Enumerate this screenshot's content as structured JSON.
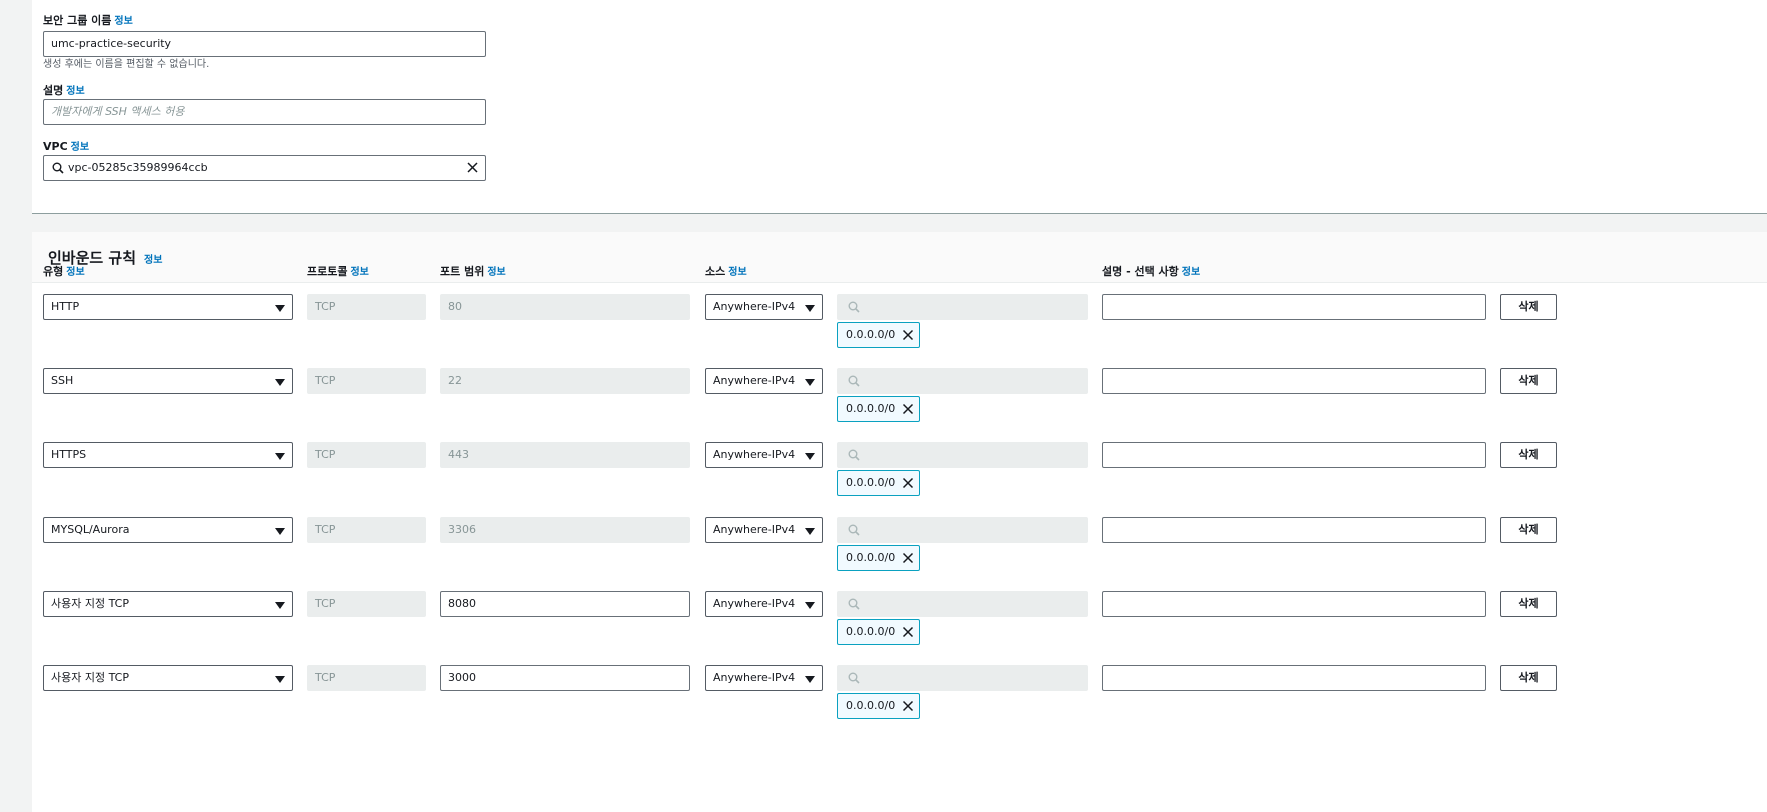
{
  "top": {
    "name_label": "보안 그룹 이름",
    "name_info": "정보",
    "name_value": "umc-practice-security",
    "name_hint": "생성 후에는 이름을 편집할 수 없습니다.",
    "desc_label": "설명",
    "desc_info": "정보",
    "desc_placeholder": "개발자에게 SSH 액세스 허용",
    "vpc_label": "VPC",
    "vpc_info": "정보",
    "vpc_value": "vpc-05285c35989964ccb"
  },
  "inbound": {
    "title": "인바운드 규칙",
    "title_info": "정보",
    "headers": {
      "type": "유형",
      "protocol": "프로토콜",
      "port": "포트 범위",
      "source": "소스",
      "description": "설명 - 선택 사항"
    },
    "info_label": "정보",
    "rows": [
      {
        "type": "HTTP",
        "protocol": "TCP",
        "port": "80",
        "port_editable": false,
        "source": "Anywhere-IPv4",
        "cidr": "0.0.0.0/0",
        "delete": "삭제"
      },
      {
        "type": "SSH",
        "protocol": "TCP",
        "port": "22",
        "port_editable": false,
        "source": "Anywhere-IPv4",
        "cidr": "0.0.0.0/0",
        "delete": "삭제"
      },
      {
        "type": "HTTPS",
        "protocol": "TCP",
        "port": "443",
        "port_editable": false,
        "source": "Anywhere-IPv4",
        "cidr": "0.0.0.0/0",
        "delete": "삭제"
      },
      {
        "type": "MYSQL/Aurora",
        "protocol": "TCP",
        "port": "3306",
        "port_editable": false,
        "source": "Anywhere-IPv4",
        "cidr": "0.0.0.0/0",
        "delete": "삭제"
      },
      {
        "type": "사용자 지정 TCP",
        "protocol": "TCP",
        "port": "8080",
        "port_editable": true,
        "source": "Anywhere-IPv4",
        "cidr": "0.0.0.0/0",
        "delete": "삭제"
      },
      {
        "type": "사용자 지정 TCP",
        "protocol": "TCP",
        "port": "3000",
        "port_editable": true,
        "source": "Anywhere-IPv4",
        "cidr": "0.0.0.0/0",
        "delete": "삭제"
      }
    ]
  },
  "colors": {
    "link": "#0073bb",
    "token_border": "#0aa1c0",
    "disabled_bg": "#eaeded",
    "page_bg": "#f2f3f3"
  },
  "icons": {
    "search": "search-icon",
    "clear": "clear-icon",
    "dropdown": "caret-down-icon",
    "remove_token": "remove-token-icon"
  }
}
